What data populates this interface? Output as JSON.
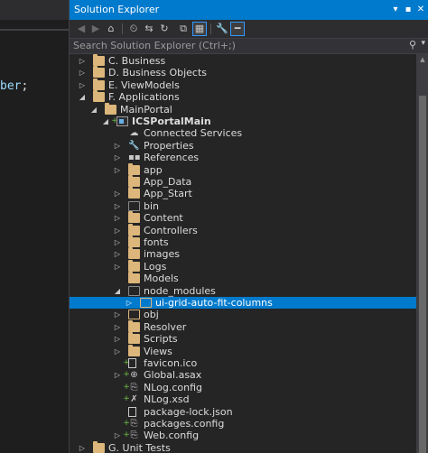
{
  "editor": {
    "code_text": "ber",
    "code_punct": ";"
  },
  "panel": {
    "title": "Solution Explorer",
    "title_buttons": [
      "▾",
      "▪",
      "✕"
    ],
    "search_placeholder": "Search Solution Explorer (Ctrl+;)",
    "toolbar_icons": [
      "back-icon",
      "forward-icon",
      "home-icon",
      "history-icon",
      "sync-icon",
      "refresh-icon",
      "collapse-all-icon",
      "show-all-files-icon",
      "properties-icon",
      "preview-icon"
    ]
  },
  "tree": [
    {
      "label": "C. Business",
      "depth": 1,
      "arrow": "collapsed",
      "icon": "folder"
    },
    {
      "label": "D. Business Objects",
      "depth": 1,
      "arrow": "collapsed",
      "icon": "folder"
    },
    {
      "label": "E. ViewModels",
      "depth": 1,
      "arrow": "collapsed",
      "icon": "folder"
    },
    {
      "label": "F. Applications",
      "depth": 1,
      "arrow": "expanded",
      "icon": "folder"
    },
    {
      "label": "MainPortal",
      "depth": 2,
      "arrow": "expanded",
      "icon": "folder"
    },
    {
      "label": "ICSPortalMain",
      "depth": 3,
      "arrow": "expanded",
      "icon": "project",
      "bold": true,
      "status": "+"
    },
    {
      "label": "Connected Services",
      "depth": 4,
      "arrow": "",
      "icon": "cloud"
    },
    {
      "label": "Properties",
      "depth": 4,
      "arrow": "collapsed",
      "icon": "wrench"
    },
    {
      "label": "References",
      "depth": 4,
      "arrow": "collapsed",
      "icon": "references"
    },
    {
      "label": "app",
      "depth": 4,
      "arrow": "collapsed",
      "icon": "folder"
    },
    {
      "label": "App_Data",
      "depth": 4,
      "arrow": "",
      "icon": "folder"
    },
    {
      "label": "App_Start",
      "depth": 4,
      "arrow": "collapsed",
      "icon": "folder"
    },
    {
      "label": "bin",
      "depth": 4,
      "arrow": "collapsed",
      "icon": "folder-outline-grey"
    },
    {
      "label": "Content",
      "depth": 4,
      "arrow": "collapsed",
      "icon": "folder"
    },
    {
      "label": "Controllers",
      "depth": 4,
      "arrow": "collapsed",
      "icon": "folder"
    },
    {
      "label": "fonts",
      "depth": 4,
      "arrow": "collapsed",
      "icon": "folder"
    },
    {
      "label": "images",
      "depth": 4,
      "arrow": "collapsed",
      "icon": "folder"
    },
    {
      "label": "Logs",
      "depth": 4,
      "arrow": "collapsed",
      "icon": "folder"
    },
    {
      "label": "Models",
      "depth": 4,
      "arrow": "",
      "icon": "folder"
    },
    {
      "label": "node_modules",
      "depth": 4,
      "arrow": "expanded",
      "icon": "folder-outline-grey"
    },
    {
      "label": "ui-grid-auto-fit-columns",
      "depth": 5,
      "arrow": "collapsed",
      "icon": "folder-outline",
      "selected": true
    },
    {
      "label": "obj",
      "depth": 4,
      "arrow": "collapsed",
      "icon": "folder-outline"
    },
    {
      "label": "Resolver",
      "depth": 4,
      "arrow": "collapsed",
      "icon": "folder"
    },
    {
      "label": "Scripts",
      "depth": 4,
      "arrow": "collapsed",
      "icon": "folder"
    },
    {
      "label": "Views",
      "depth": 4,
      "arrow": "collapsed",
      "icon": "folder"
    },
    {
      "label": "favicon.ico",
      "depth": 4,
      "arrow": "",
      "icon": "file",
      "status": "+"
    },
    {
      "label": "Global.asax",
      "depth": 4,
      "arrow": "collapsed",
      "icon": "globe",
      "status": "+"
    },
    {
      "label": "NLog.config",
      "depth": 4,
      "arrow": "",
      "icon": "config",
      "status": "+"
    },
    {
      "label": "NLog.xsd",
      "depth": 4,
      "arrow": "",
      "icon": "xsd",
      "status": "+"
    },
    {
      "label": "package-lock.json",
      "depth": 4,
      "arrow": "",
      "icon": "file"
    },
    {
      "label": "packages.config",
      "depth": 4,
      "arrow": "",
      "icon": "config",
      "status": "+"
    },
    {
      "label": "Web.config",
      "depth": 4,
      "arrow": "collapsed",
      "icon": "config",
      "status": "+"
    },
    {
      "label": "G. Unit Tests",
      "depth": 1,
      "arrow": "collapsed",
      "icon": "folder"
    }
  ]
}
